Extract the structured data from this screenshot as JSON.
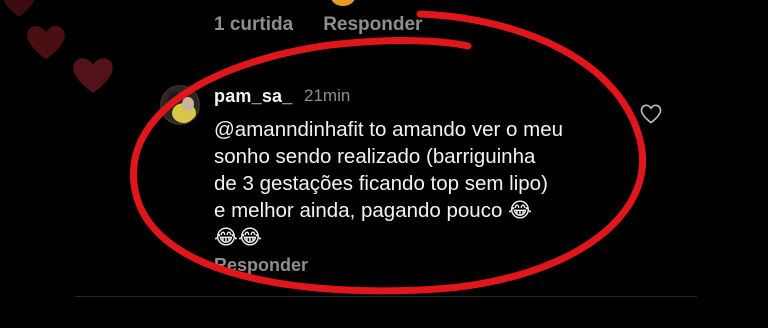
{
  "previous_comment": {
    "likes_label": "1 curtida",
    "reply_label": "Responder"
  },
  "comment": {
    "username": "pam_sa_",
    "timestamp": "21min",
    "lines": [
      "@amanndinhafit to amando ver o meu",
      "sonho sendo realizado (barriguinha",
      "de 3 gestações ficando top sem lipo)",
      "e melhor ainda, pagando pouco 😂",
      "😂😂"
    ],
    "reply_label": "Responder",
    "like_icon": "heart-outline-icon"
  },
  "colors": {
    "background": "#000000",
    "primary_text": "#f2f2f2",
    "secondary_text": "#8e8e8e",
    "annotation_red": "#e0161b",
    "floating_hearts": "#4a0f12"
  }
}
